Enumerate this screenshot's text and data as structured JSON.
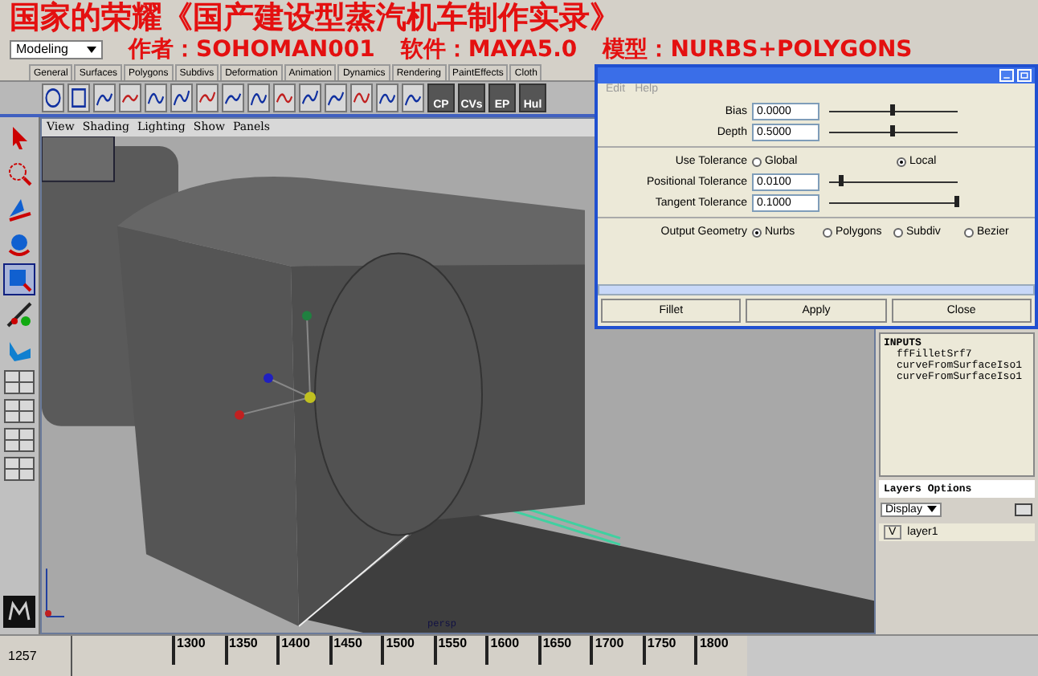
{
  "overlay_title": "国家的荣耀《国产建设型蒸汽机车制作实录》",
  "overlay_credits": [
    {
      "label": "作者：",
      "value": "SOHOMAN001"
    },
    {
      "label": "软件：",
      "value": "MAYA5.0"
    },
    {
      "label": "模型：",
      "value": "NURBS+POLYGONS"
    }
  ],
  "mode_menu": {
    "value": "Modeling"
  },
  "shelf_tabs": [
    "General",
    "Surfaces",
    "Polygons",
    "Subdivs",
    "Deformation",
    "Animation",
    "Dynamics",
    "Rendering",
    "PaintEffects",
    "Cloth"
  ],
  "shelf_buttons": [
    "CP",
    "CVs",
    "EP",
    "Hul"
  ],
  "tools": [
    {
      "selected": false
    },
    {
      "selected": false
    },
    {
      "selected": false
    },
    {
      "selected": false
    },
    {
      "selected": true
    },
    {
      "selected": false
    },
    {
      "selected": false
    }
  ],
  "viewport": {
    "menu": [
      "View",
      "Shading",
      "Lighting",
      "Show",
      "Panels"
    ],
    "camera_label": "persp"
  },
  "dialog": {
    "menu": [
      "Edit",
      "Help"
    ],
    "fields": [
      {
        "label": "Bias",
        "value": "0.0000",
        "level": 0.5
      },
      {
        "label": "Depth",
        "value": "0.5000",
        "level": 0.5
      }
    ],
    "use_tolerance": {
      "label": "Use Tolerance",
      "options": [
        {
          "label": "Global",
          "selected": false
        },
        {
          "label": "Local",
          "selected": true
        }
      ]
    },
    "tolerances": [
      {
        "label": "Positional Tolerance",
        "value": "0.0100",
        "level": 0.1
      },
      {
        "label": "Tangent Tolerance",
        "value": "0.1000",
        "level": 1
      }
    ],
    "output_geometry": {
      "label": "Output Geometry",
      "options": [
        {
          "label": "Nurbs",
          "selected": true
        },
        {
          "label": "Polygons",
          "selected": false
        },
        {
          "label": "Subdiv",
          "selected": false
        },
        {
          "label": "Bezier",
          "selected": false
        }
      ]
    },
    "buttons": [
      "Fillet",
      "Apply",
      "Close"
    ]
  },
  "channel_box": {
    "heading": "INPUTS",
    "items": [
      "ffFilletSrf7",
      "curveFromSurfaceIso1",
      "curveFromSurfaceIso1"
    ]
  },
  "layers": {
    "menu": [
      "Layers",
      "Options"
    ],
    "display": "Display",
    "rows": [
      {
        "visible_mark": "V",
        "name": "layer1"
      }
    ]
  },
  "timeline": {
    "current": "1257",
    "ticks": [
      "1300",
      "1350",
      "1400",
      "1450",
      "1500",
      "1550",
      "1600",
      "1650",
      "1700",
      "1750",
      "1800"
    ]
  }
}
